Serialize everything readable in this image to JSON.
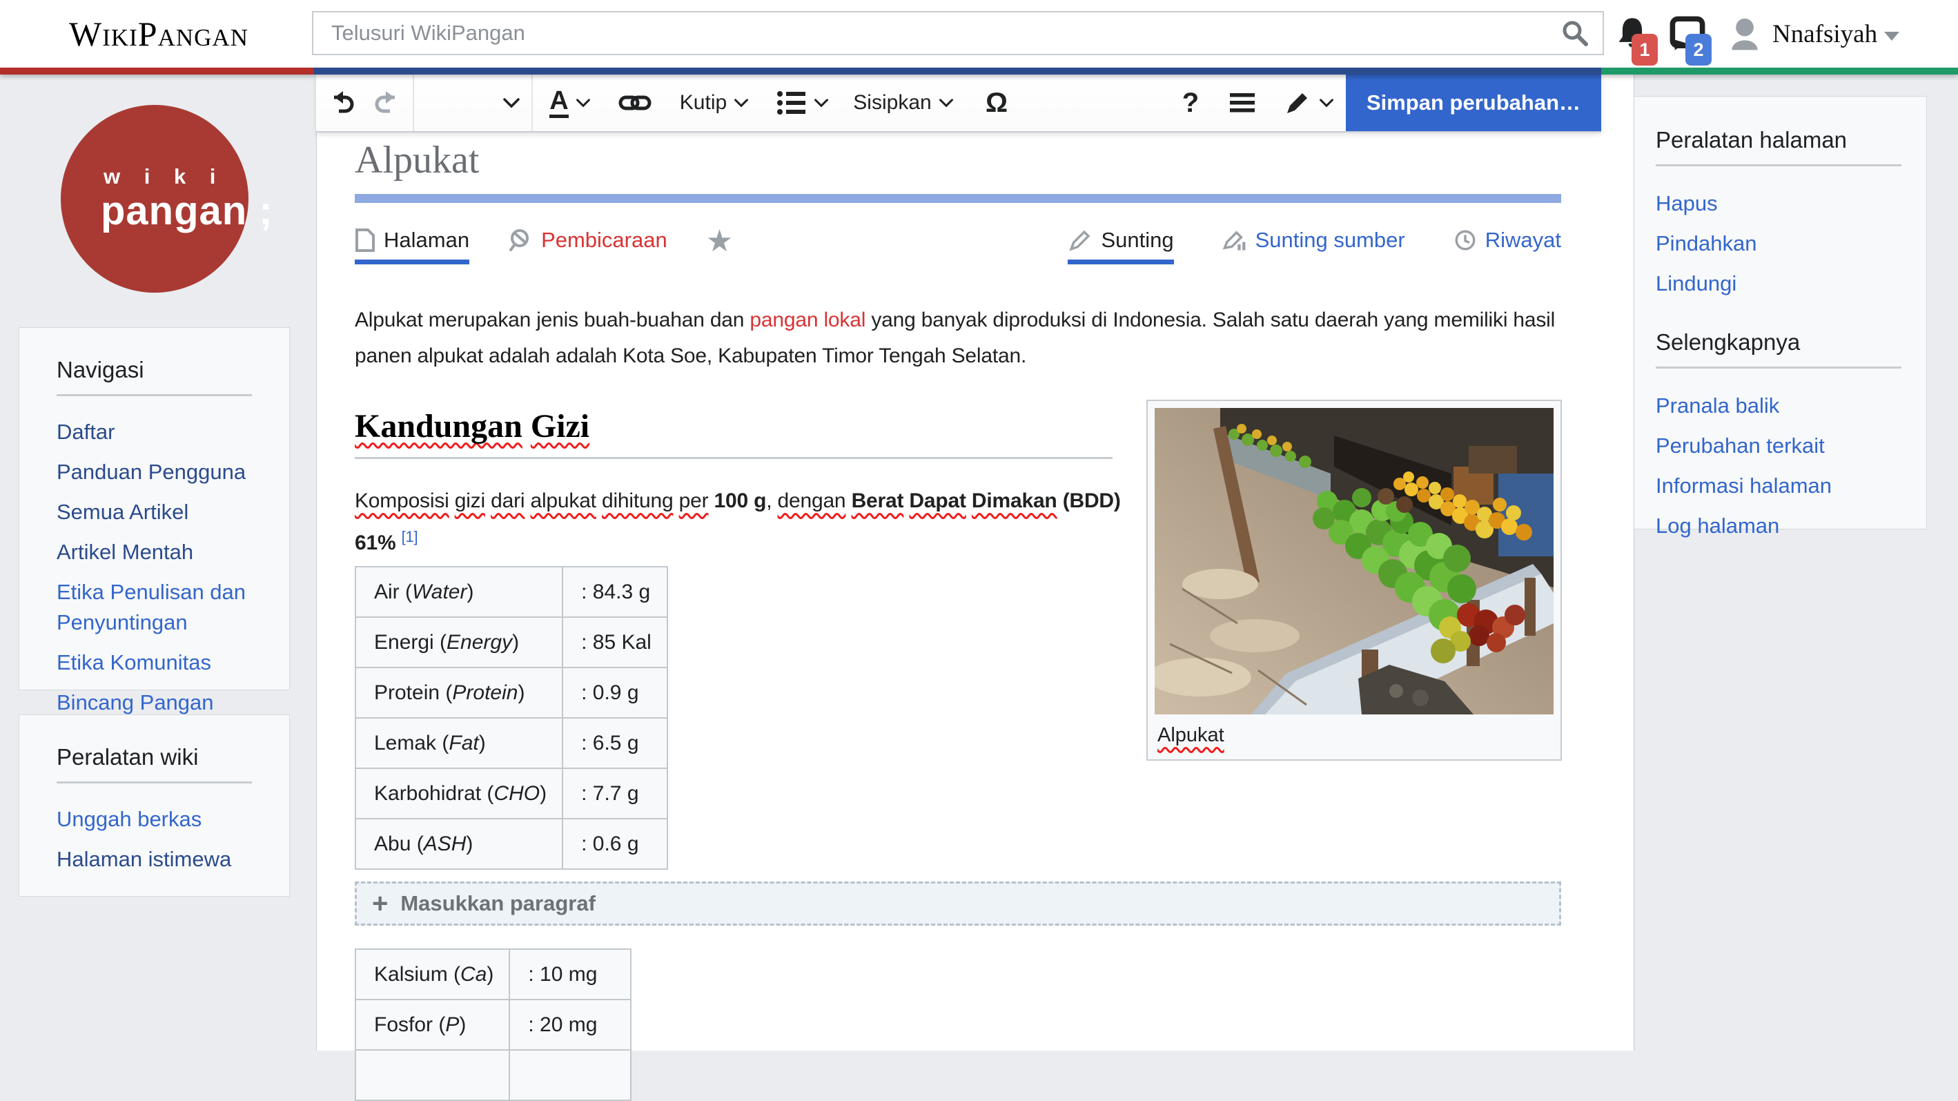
{
  "header": {
    "logo_text": "WikiPangan",
    "search_placeholder": "Telusuri WikiPangan",
    "notifications": {
      "alerts_count": "1",
      "messages_count": "2"
    },
    "username": "Nnafsiyah"
  },
  "toolbar": {
    "format_letter": "A",
    "kutip_label": "Kutip",
    "sisipkan_label": "Sisipkan",
    "omega_glyph": "Ω",
    "help_glyph": "?",
    "save_label": "Simpan perubahan…"
  },
  "tabs": {
    "halaman": "Halaman",
    "pembicaraan": "Pembicaraan",
    "sunting": "Sunting",
    "sunting_sumber": "Sunting sumber",
    "riwayat": "Riwayat"
  },
  "article": {
    "title": "Alpukat",
    "intro_tokens": [
      {
        "t": "Alpukat merupakan jenis buah-buahan dan"
      },
      {
        "t": "pangan lokal",
        "red": 1
      },
      {
        "t": "yang banyak diproduksi di Indonesia. Salah satu daerah yang memiliki hasil panen alpukat adalah adalah Kota Soe, Kabupaten Timor Tengah Selatan."
      }
    ],
    "section_heading_tokens": [
      {
        "t": "Kandungan",
        "sq": 1
      },
      {
        "t": "Gizi",
        "sq": 1
      }
    ],
    "komposisi_tokens": [
      {
        "t": "Komposisi",
        "sq": 1
      },
      {
        "t": "gizi",
        "sq": 1
      },
      {
        "t": "dari",
        "sq": 1
      },
      {
        "t": "alpukat",
        "sq": 1
      },
      {
        "t": "dihitung",
        "sq": 1
      },
      {
        "t": "per",
        "sq": 1
      },
      {
        "t": "100 g",
        "b": 1
      },
      {
        "t": ",",
        "glue": 1
      },
      {
        "t": "dengan",
        "sq": 1
      },
      {
        "t": "Berat",
        "b": 1,
        "sq": 1
      },
      {
        "t": "Dapat",
        "b": 1,
        "sq": 1
      },
      {
        "t": "Dimakan",
        "b": 1,
        "sq": 1
      },
      {
        "t": "(BDD) 61%",
        "b": 1
      },
      {
        "t": "[1]",
        "sup": 1
      }
    ],
    "gizi_table": [
      {
        "name": "Air",
        "paren": "Water",
        "value": ": 84.3 g"
      },
      {
        "name": "Energi",
        "paren": "Energy",
        "value": ": 85 Kal"
      },
      {
        "name": "Protein",
        "paren": "Protein",
        "value": ": 0.9 g"
      },
      {
        "name": "Lemak",
        "paren": "Fat",
        "value": ": 6.5 g"
      },
      {
        "name": "Karbohidrat",
        "paren": "CHO",
        "value": ": 7.7 g"
      },
      {
        "name": "Abu",
        "paren": "ASH",
        "value": ": 0.6 g"
      }
    ],
    "image_caption": "Alpukat",
    "insert_paragraph_label": "Masukkan paragraf",
    "mineral_table": [
      {
        "name": "Kalsium",
        "paren": "Ca",
        "value": ": 10 mg"
      },
      {
        "name": "Fosfor",
        "paren": "P",
        "value": ": 20 mg"
      },
      {
        "name": "",
        "paren": "",
        "value": ""
      }
    ]
  },
  "left_sidebar": {
    "logo_line1": "w i k i",
    "logo_line2": "pangan ;",
    "navigasi_heading": "Navigasi",
    "navigasi_items": [
      {
        "label": "Daftar",
        "variant": "dark"
      },
      {
        "label": "Panduan Pengguna",
        "variant": "dark"
      },
      {
        "label": "Semua Artikel",
        "variant": "dark"
      },
      {
        "label": "Artikel Mentah",
        "variant": "dark"
      },
      {
        "label": "Etika Penulisan dan Penyuntingan",
        "variant": "bright"
      },
      {
        "label": "Etika Komunitas",
        "variant": "bright"
      },
      {
        "label": "Bincang Pangan",
        "variant": "bright"
      }
    ],
    "peralatan_heading": "Peralatan wiki",
    "peralatan_items": [
      {
        "label": "Unggah berkas",
        "variant": "bright"
      },
      {
        "label": "Halaman istimewa",
        "variant": "dark"
      }
    ]
  },
  "right_sidebar": {
    "tools_heading": "Peralatan halaman",
    "tools_items": [
      {
        "label": "Hapus",
        "variant": "bright"
      },
      {
        "label": "Pindahkan",
        "variant": "bright"
      },
      {
        "label": "Lindungi",
        "variant": "bright"
      }
    ],
    "more_heading": "Selengkapnya",
    "more_items": [
      {
        "label": "Pranala balik",
        "variant": "bright"
      },
      {
        "label": "Perubahan terkait",
        "variant": "bright"
      },
      {
        "label": "Informasi halaman",
        "variant": "bright"
      },
      {
        "label": "Log halaman",
        "variant": "bright"
      }
    ]
  },
  "colors": {
    "stripe_red": "#b32d29",
    "stripe_blue": "#2a4b8d",
    "stripe_green": "#1d9a68",
    "save_button_blue": "#3366cc",
    "link_blue": "#3366cc",
    "link_visited": "#2a4b8d",
    "red_link": "#d73333",
    "spellcheck_squiggle": "#f21d1d",
    "logo_circle_red": "#a93a33",
    "title_underline_blue": "#8ea9e1",
    "page_background": "#eaecf0",
    "panel_background": "#f8f9fa"
  }
}
